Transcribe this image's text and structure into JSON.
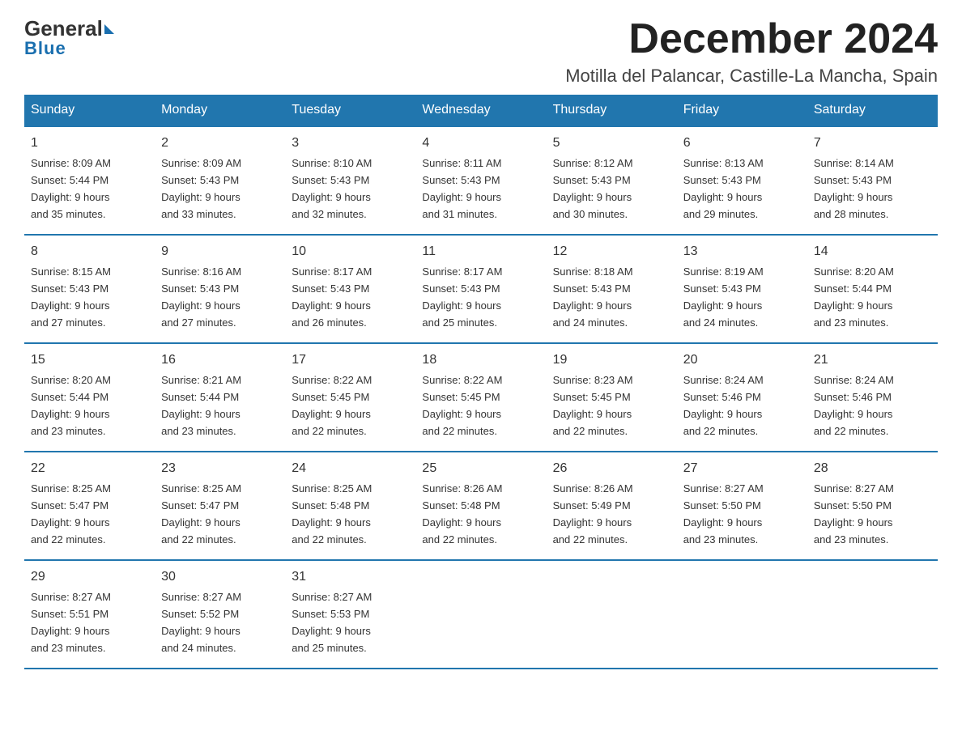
{
  "header": {
    "logo_general": "General",
    "logo_blue": "Blue",
    "month_title": "December 2024",
    "location": "Motilla del Palancar, Castille-La Mancha, Spain"
  },
  "days_of_week": [
    "Sunday",
    "Monday",
    "Tuesday",
    "Wednesday",
    "Thursday",
    "Friday",
    "Saturday"
  ],
  "weeks": [
    [
      {
        "day": "1",
        "sunrise": "8:09 AM",
        "sunset": "5:44 PM",
        "daylight": "9 hours and 35 minutes."
      },
      {
        "day": "2",
        "sunrise": "8:09 AM",
        "sunset": "5:43 PM",
        "daylight": "9 hours and 33 minutes."
      },
      {
        "day": "3",
        "sunrise": "8:10 AM",
        "sunset": "5:43 PM",
        "daylight": "9 hours and 32 minutes."
      },
      {
        "day": "4",
        "sunrise": "8:11 AM",
        "sunset": "5:43 PM",
        "daylight": "9 hours and 31 minutes."
      },
      {
        "day": "5",
        "sunrise": "8:12 AM",
        "sunset": "5:43 PM",
        "daylight": "9 hours and 30 minutes."
      },
      {
        "day": "6",
        "sunrise": "8:13 AM",
        "sunset": "5:43 PM",
        "daylight": "9 hours and 29 minutes."
      },
      {
        "day": "7",
        "sunrise": "8:14 AM",
        "sunset": "5:43 PM",
        "daylight": "9 hours and 28 minutes."
      }
    ],
    [
      {
        "day": "8",
        "sunrise": "8:15 AM",
        "sunset": "5:43 PM",
        "daylight": "9 hours and 27 minutes."
      },
      {
        "day": "9",
        "sunrise": "8:16 AM",
        "sunset": "5:43 PM",
        "daylight": "9 hours and 27 minutes."
      },
      {
        "day": "10",
        "sunrise": "8:17 AM",
        "sunset": "5:43 PM",
        "daylight": "9 hours and 26 minutes."
      },
      {
        "day": "11",
        "sunrise": "8:17 AM",
        "sunset": "5:43 PM",
        "daylight": "9 hours and 25 minutes."
      },
      {
        "day": "12",
        "sunrise": "8:18 AM",
        "sunset": "5:43 PM",
        "daylight": "9 hours and 24 minutes."
      },
      {
        "day": "13",
        "sunrise": "8:19 AM",
        "sunset": "5:43 PM",
        "daylight": "9 hours and 24 minutes."
      },
      {
        "day": "14",
        "sunrise": "8:20 AM",
        "sunset": "5:44 PM",
        "daylight": "9 hours and 23 minutes."
      }
    ],
    [
      {
        "day": "15",
        "sunrise": "8:20 AM",
        "sunset": "5:44 PM",
        "daylight": "9 hours and 23 minutes."
      },
      {
        "day": "16",
        "sunrise": "8:21 AM",
        "sunset": "5:44 PM",
        "daylight": "9 hours and 23 minutes."
      },
      {
        "day": "17",
        "sunrise": "8:22 AM",
        "sunset": "5:45 PM",
        "daylight": "9 hours and 22 minutes."
      },
      {
        "day": "18",
        "sunrise": "8:22 AM",
        "sunset": "5:45 PM",
        "daylight": "9 hours and 22 minutes."
      },
      {
        "day": "19",
        "sunrise": "8:23 AM",
        "sunset": "5:45 PM",
        "daylight": "9 hours and 22 minutes."
      },
      {
        "day": "20",
        "sunrise": "8:24 AM",
        "sunset": "5:46 PM",
        "daylight": "9 hours and 22 minutes."
      },
      {
        "day": "21",
        "sunrise": "8:24 AM",
        "sunset": "5:46 PM",
        "daylight": "9 hours and 22 minutes."
      }
    ],
    [
      {
        "day": "22",
        "sunrise": "8:25 AM",
        "sunset": "5:47 PM",
        "daylight": "9 hours and 22 minutes."
      },
      {
        "day": "23",
        "sunrise": "8:25 AM",
        "sunset": "5:47 PM",
        "daylight": "9 hours and 22 minutes."
      },
      {
        "day": "24",
        "sunrise": "8:25 AM",
        "sunset": "5:48 PM",
        "daylight": "9 hours and 22 minutes."
      },
      {
        "day": "25",
        "sunrise": "8:26 AM",
        "sunset": "5:48 PM",
        "daylight": "9 hours and 22 minutes."
      },
      {
        "day": "26",
        "sunrise": "8:26 AM",
        "sunset": "5:49 PM",
        "daylight": "9 hours and 22 minutes."
      },
      {
        "day": "27",
        "sunrise": "8:27 AM",
        "sunset": "5:50 PM",
        "daylight": "9 hours and 23 minutes."
      },
      {
        "day": "28",
        "sunrise": "8:27 AM",
        "sunset": "5:50 PM",
        "daylight": "9 hours and 23 minutes."
      }
    ],
    [
      {
        "day": "29",
        "sunrise": "8:27 AM",
        "sunset": "5:51 PM",
        "daylight": "9 hours and 23 minutes."
      },
      {
        "day": "30",
        "sunrise": "8:27 AM",
        "sunset": "5:52 PM",
        "daylight": "9 hours and 24 minutes."
      },
      {
        "day": "31",
        "sunrise": "8:27 AM",
        "sunset": "5:53 PM",
        "daylight": "9 hours and 25 minutes."
      },
      null,
      null,
      null,
      null
    ]
  ],
  "labels": {
    "sunrise": "Sunrise:",
    "sunset": "Sunset:",
    "daylight": "Daylight:"
  }
}
